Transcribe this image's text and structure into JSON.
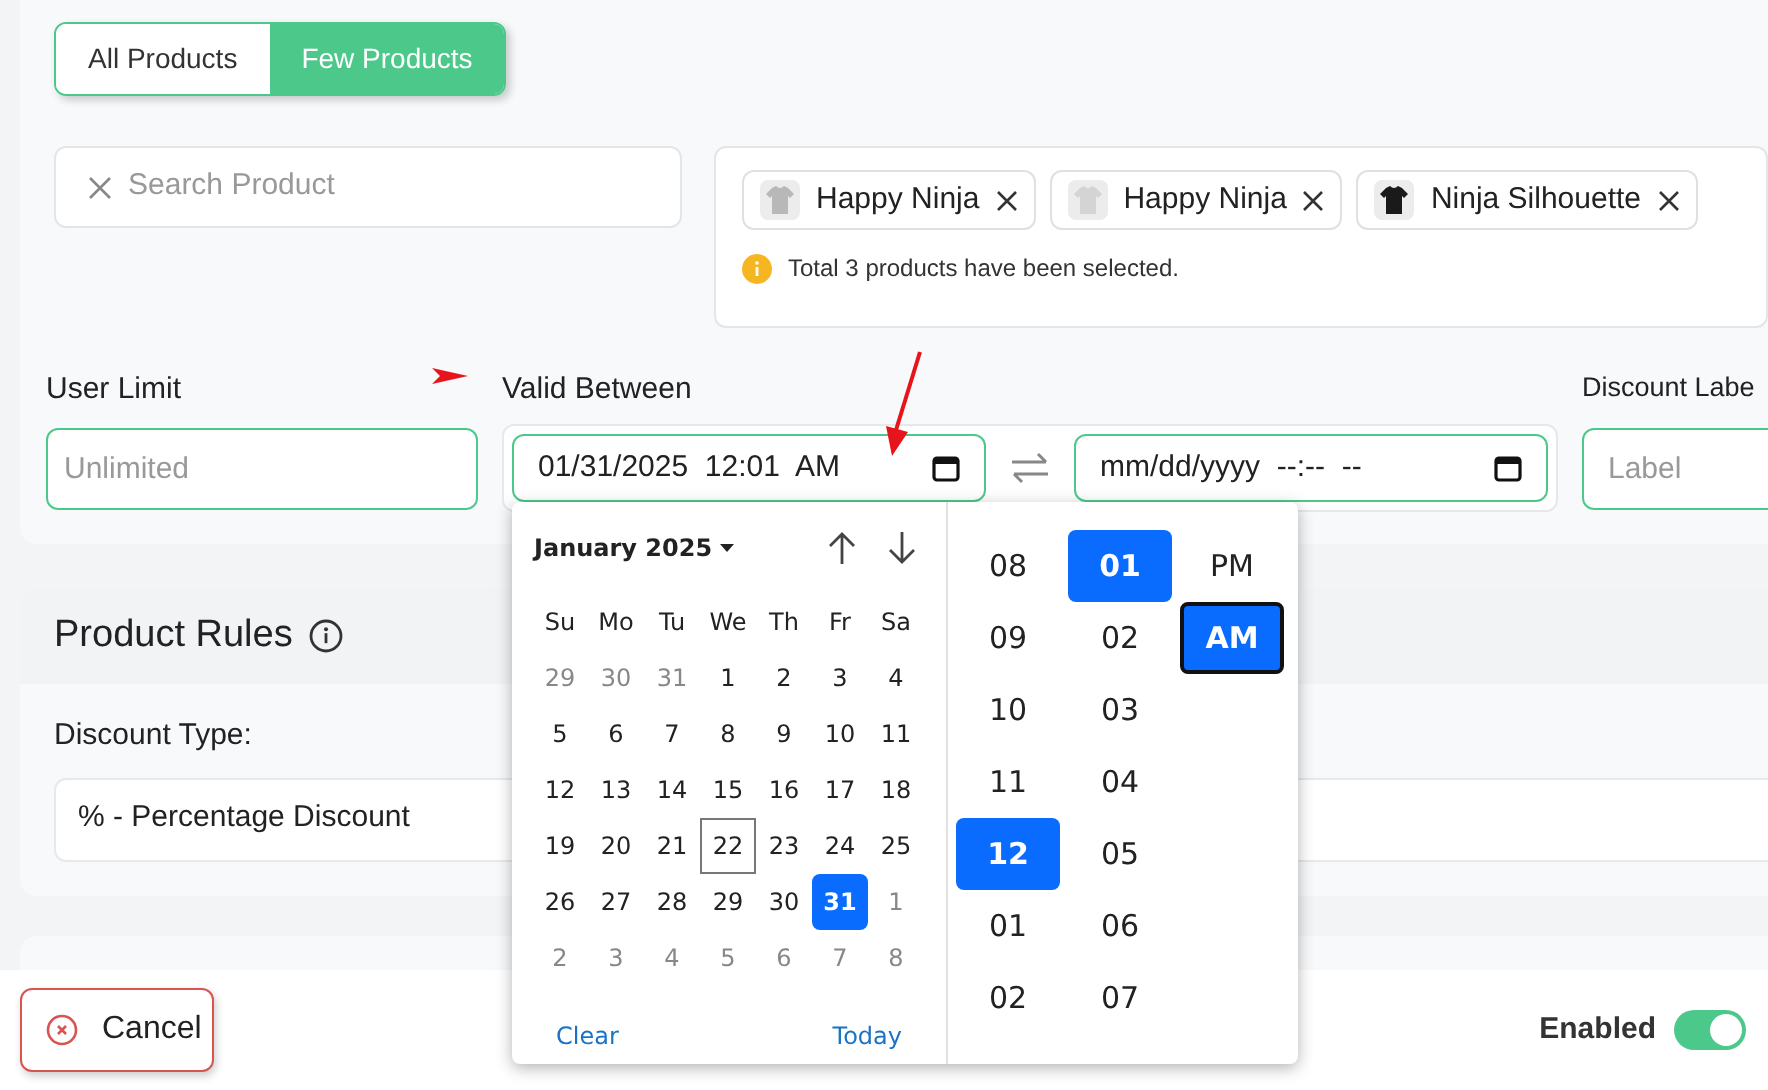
{
  "scope_tabs": [
    {
      "label": "All Products",
      "selected": false
    },
    {
      "label": "Few Products",
      "selected": true
    }
  ],
  "product_search": {
    "placeholder": "Search Product"
  },
  "selected_products": {
    "items": [
      {
        "name": "Happy Ninja",
        "color": "#b8b8b8"
      },
      {
        "name": "Happy Ninja",
        "color": "#d4d4d4"
      },
      {
        "name": "Ninja Silhouette",
        "color": "#1a1a1a"
      }
    ],
    "note": "Total 3 products have been selected."
  },
  "user_limit": {
    "label": "User Limit",
    "placeholder": "Unlimited"
  },
  "valid_between": {
    "label": "Valid Between",
    "start": "01/31/2025  12:01  AM",
    "end_placeholder": "mm/dd/yyyy  --:--  --"
  },
  "discount_label": {
    "label": "Discount Labe",
    "placeholder": "Label"
  },
  "date_picker": {
    "month": "January 2025",
    "weekdays": [
      "Su",
      "Mo",
      "Tu",
      "We",
      "Th",
      "Fr",
      "Sa"
    ],
    "days": [
      {
        "label": "29",
        "outside": true,
        "selected": false,
        "today": false
      },
      {
        "label": "30",
        "outside": true,
        "selected": false,
        "today": false
      },
      {
        "label": "31",
        "outside": true,
        "selected": false,
        "today": false
      },
      {
        "label": "1",
        "outside": false,
        "selected": false,
        "today": false
      },
      {
        "label": "2",
        "outside": false,
        "selected": false,
        "today": false
      },
      {
        "label": "3",
        "outside": false,
        "selected": false,
        "today": false
      },
      {
        "label": "4",
        "outside": false,
        "selected": false,
        "today": false
      },
      {
        "label": "5",
        "outside": false,
        "selected": false,
        "today": false
      },
      {
        "label": "6",
        "outside": false,
        "selected": false,
        "today": false
      },
      {
        "label": "7",
        "outside": false,
        "selected": false,
        "today": false
      },
      {
        "label": "8",
        "outside": false,
        "selected": false,
        "today": false
      },
      {
        "label": "9",
        "outside": false,
        "selected": false,
        "today": false
      },
      {
        "label": "10",
        "outside": false,
        "selected": false,
        "today": false
      },
      {
        "label": "11",
        "outside": false,
        "selected": false,
        "today": false
      },
      {
        "label": "12",
        "outside": false,
        "selected": false,
        "today": false
      },
      {
        "label": "13",
        "outside": false,
        "selected": false,
        "today": false
      },
      {
        "label": "14",
        "outside": false,
        "selected": false,
        "today": false
      },
      {
        "label": "15",
        "outside": false,
        "selected": false,
        "today": false
      },
      {
        "label": "16",
        "outside": false,
        "selected": false,
        "today": false
      },
      {
        "label": "17",
        "outside": false,
        "selected": false,
        "today": false
      },
      {
        "label": "18",
        "outside": false,
        "selected": false,
        "today": false
      },
      {
        "label": "19",
        "outside": false,
        "selected": false,
        "today": false
      },
      {
        "label": "20",
        "outside": false,
        "selected": false,
        "today": false
      },
      {
        "label": "21",
        "outside": false,
        "selected": false,
        "today": false
      },
      {
        "label": "22",
        "outside": false,
        "selected": false,
        "today": true
      },
      {
        "label": "23",
        "outside": false,
        "selected": false,
        "today": false
      },
      {
        "label": "24",
        "outside": false,
        "selected": false,
        "today": false
      },
      {
        "label": "25",
        "outside": false,
        "selected": false,
        "today": false
      },
      {
        "label": "26",
        "outside": false,
        "selected": false,
        "today": false
      },
      {
        "label": "27",
        "outside": false,
        "selected": false,
        "today": false
      },
      {
        "label": "28",
        "outside": false,
        "selected": false,
        "today": false
      },
      {
        "label": "29",
        "outside": false,
        "selected": false,
        "today": false
      },
      {
        "label": "30",
        "outside": false,
        "selected": false,
        "today": false
      },
      {
        "label": "31",
        "outside": false,
        "selected": true,
        "today": false
      },
      {
        "label": "1",
        "outside": true,
        "selected": false,
        "today": false
      },
      {
        "label": "2",
        "outside": true,
        "selected": false,
        "today": false
      },
      {
        "label": "3",
        "outside": true,
        "selected": false,
        "today": false
      },
      {
        "label": "4",
        "outside": true,
        "selected": false,
        "today": false
      },
      {
        "label": "5",
        "outside": true,
        "selected": false,
        "today": false
      },
      {
        "label": "6",
        "outside": true,
        "selected": false,
        "today": false
      },
      {
        "label": "7",
        "outside": true,
        "selected": false,
        "today": false
      },
      {
        "label": "8",
        "outside": true,
        "selected": false,
        "today": false
      }
    ],
    "clear": "Clear",
    "today": "Today",
    "hours": [
      {
        "label": "08",
        "selected": false
      },
      {
        "label": "09",
        "selected": false
      },
      {
        "label": "10",
        "selected": false
      },
      {
        "label": "11",
        "selected": false
      },
      {
        "label": "12",
        "selected": true
      },
      {
        "label": "01",
        "selected": false
      },
      {
        "label": "02",
        "selected": false
      }
    ],
    "minutes": [
      {
        "label": "01",
        "selected": true
      },
      {
        "label": "02",
        "selected": false
      },
      {
        "label": "03",
        "selected": false
      },
      {
        "label": "04",
        "selected": false
      },
      {
        "label": "05",
        "selected": false
      },
      {
        "label": "06",
        "selected": false
      },
      {
        "label": "07",
        "selected": false
      }
    ],
    "periods": [
      {
        "label": "PM",
        "selected": false
      },
      {
        "label": "AM",
        "selected": true
      }
    ]
  },
  "product_rules": {
    "title": "Product Rules",
    "discount_type_label": "Discount Type:",
    "discount_type": "% - Percentage Discount"
  },
  "footer": {
    "cancel": "Cancel",
    "enabled_label": "Enabled",
    "enabled": true
  }
}
